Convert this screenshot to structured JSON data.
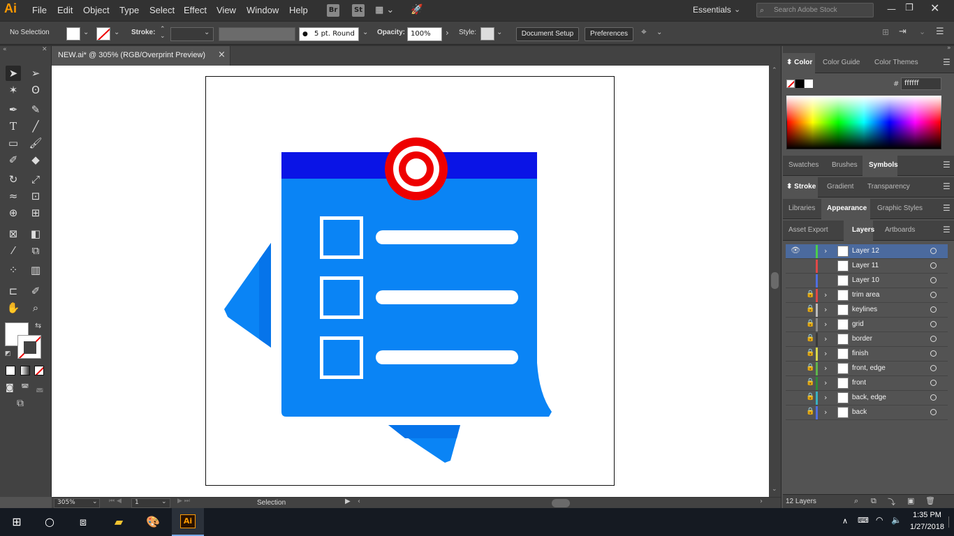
{
  "app": {
    "logo": "Ai",
    "workspace": "Essentials",
    "search_placeholder": "Search Adobe Stock"
  },
  "menu": [
    "File",
    "Edit",
    "Object",
    "Type",
    "Select",
    "Effect",
    "View",
    "Window",
    "Help"
  ],
  "app_icons": {
    "bridge": "Br",
    "stock": "St"
  },
  "control": {
    "selection": "No Selection",
    "stroke_label": "Stroke:",
    "brush": "5 pt. Round",
    "opacity_label": "Opacity:",
    "opacity": "100%",
    "style_label": "Style:",
    "document_setup": "Document Setup",
    "preferences": "Preferences"
  },
  "document": {
    "tab_title": "NEW.ai* @ 305% (RGB/Overprint Preview)",
    "close": "×"
  },
  "status": {
    "zoom": "305%",
    "artboard": "1",
    "tool": "Selection"
  },
  "panels": {
    "color_tabs": [
      "Color",
      "Color Guide",
      "Color Themes"
    ],
    "hex_label": "#",
    "hex": "ffffff",
    "row2_tabs": [
      "Swatches",
      "Brushes",
      "Symbols"
    ],
    "row3_tabs": [
      "Stroke",
      "Gradient",
      "Transparency"
    ],
    "row4_tabs": [
      "Libraries",
      "Appearance",
      "Graphic Styles"
    ],
    "row5_tabs": [
      "Asset Export",
      "Layers",
      "Artboards"
    ],
    "layers_count": "12 Layers"
  },
  "layers": [
    {
      "name": "Layer 12",
      "color": "#4ccc4c",
      "locked": false,
      "visible": true,
      "chev": true,
      "selected": true
    },
    {
      "name": "Layer 11",
      "color": "#e04848",
      "locked": false,
      "visible": false,
      "chev": false
    },
    {
      "name": "Layer 10",
      "color": "#4f6fe0",
      "locked": false,
      "visible": false,
      "chev": false
    },
    {
      "name": "trim area",
      "color": "#e04848",
      "locked": true,
      "visible": false,
      "chev": true
    },
    {
      "name": "keylines",
      "color": "#bbbbbb",
      "locked": true,
      "visible": false,
      "chev": true
    },
    {
      "name": "grid",
      "color": "#888888",
      "locked": true,
      "visible": false,
      "chev": true
    },
    {
      "name": "border",
      "color": "#3a3a3a",
      "locked": true,
      "visible": false,
      "chev": true
    },
    {
      "name": "finish",
      "color": "#d8d84a",
      "locked": true,
      "visible": false,
      "chev": true
    },
    {
      "name": "front, edge",
      "color": "#5fb44c",
      "locked": true,
      "visible": false,
      "chev": true
    },
    {
      "name": "front",
      "color": "#2e8b3a",
      "locked": true,
      "visible": false,
      "chev": true
    },
    {
      "name": "back, edge",
      "color": "#39b0c0",
      "locked": true,
      "visible": false,
      "chev": true
    },
    {
      "name": "back",
      "color": "#4f6fe0",
      "locked": true,
      "visible": false,
      "chev": true
    }
  ],
  "taskbar": {
    "time": "1:35 PM",
    "date": "1/27/2018",
    "ai_label": "Ai"
  },
  "colors": {
    "note_blue": "#0a84f5",
    "note_top": "#0a14e6",
    "pin_red": "#ee0000",
    "accent_orange": "#ff9a00"
  }
}
